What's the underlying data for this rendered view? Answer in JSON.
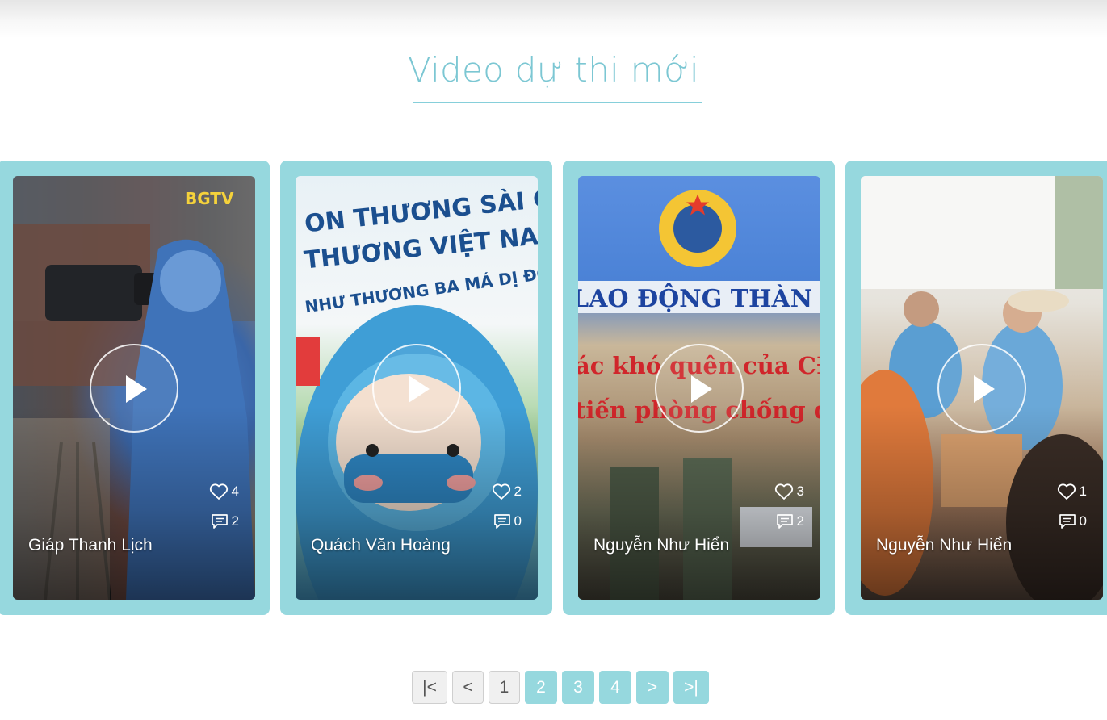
{
  "section": {
    "title": "Video dự thi mới"
  },
  "videos": [
    {
      "author": "Giáp Thanh Lịch",
      "likes": "4",
      "comments": "2",
      "theme_color": "#6f8fb5"
    },
    {
      "author": "Quách Văn Hoàng",
      "likes": "2",
      "comments": "0",
      "theme_color": "#4fa3cf"
    },
    {
      "author": "Nguyễn Như Hiển",
      "likes": "3",
      "comments": "2",
      "theme_color": "#8a8f74"
    },
    {
      "author": "Nguyễn Như Hiển",
      "likes": "1",
      "comments": "0",
      "theme_color": "#c9b49a"
    }
  ],
  "pagination": {
    "first": "|<",
    "prev": "<",
    "pages": [
      "1",
      "2",
      "3",
      "4"
    ],
    "current": "1",
    "next": ">",
    "last": ">|"
  },
  "colors": {
    "accent": "#96d8de",
    "title": "#7cc7d3"
  },
  "icons": {
    "play": "play-icon",
    "like": "heart-icon",
    "comment": "comment-icon"
  }
}
